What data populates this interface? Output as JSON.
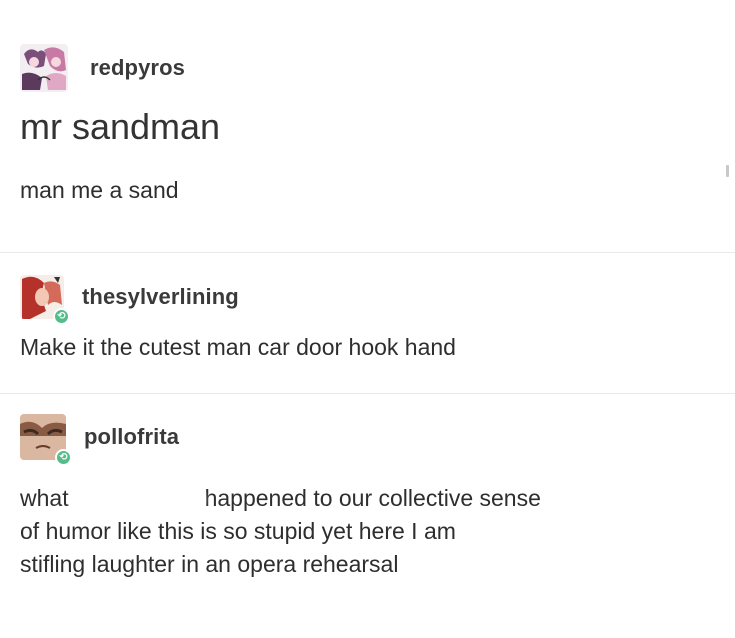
{
  "posts": [
    {
      "username": "redpyros",
      "title": "mr sandman",
      "body": "man me a sand",
      "avatar_icon": "avatar-anime-icon"
    },
    {
      "username": "thesylverlining",
      "body": "Make it the cutest man car door hook hand",
      "avatar_icon": "avatar-red-hair-icon",
      "reblog_icon": "reblog-icon"
    },
    {
      "username": "pollofrita",
      "body_lines": [
        "what",
        "happened to our collective sense",
        "of humor like this is so stupid yet here I am",
        "stifling laughter in an opera rehearsal"
      ],
      "avatar_icon": "avatar-face-icon",
      "reblog_icon": "reblog-icon"
    }
  ],
  "colors": {
    "reblog_badge": "#56bc8a",
    "divider": "#e9e9e9",
    "text": "#2e2e2e"
  }
}
